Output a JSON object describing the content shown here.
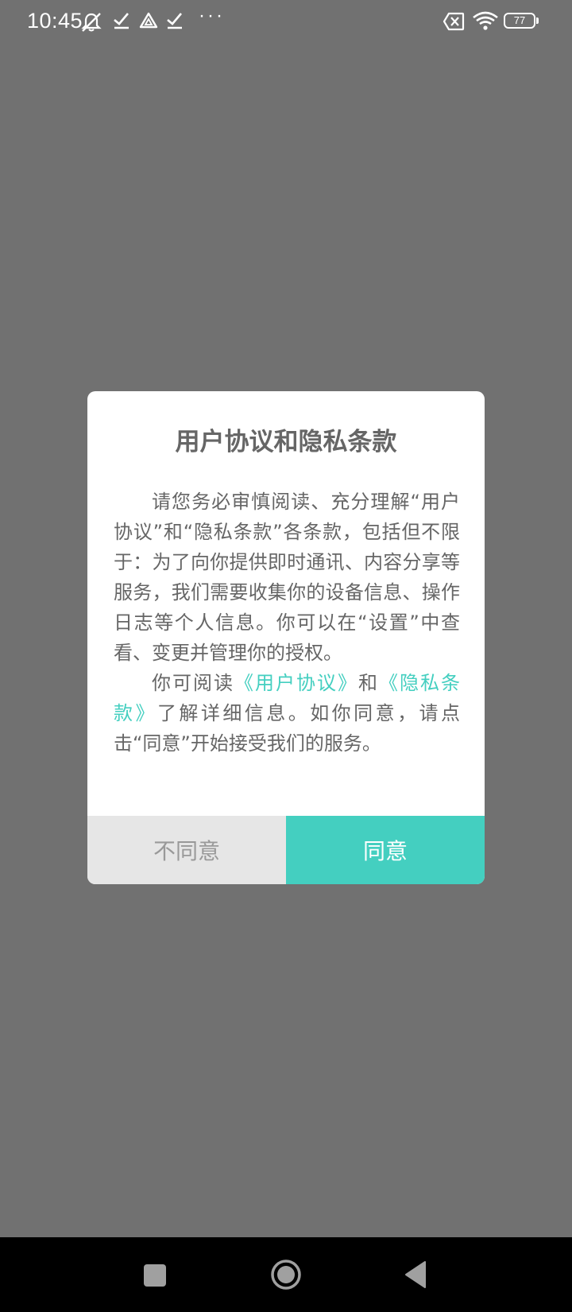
{
  "status_bar": {
    "time": "10:45",
    "overflow_dots": "···",
    "battery_level": "77",
    "icons": [
      "mute-icon",
      "check-icon",
      "drive-icon",
      "check-icon",
      "sim-absent-icon",
      "wifi-icon",
      "battery-icon"
    ]
  },
  "dialog": {
    "title": "用户协议和隐私条款",
    "paragraph1": "请您务必审慎阅读、充分理解“用户协议”和“隐私条款”各条款，包括但不限于：为了向你提供即时通讯、内容分享等服务，我们需要收集你的设备信息、操作日志等个人信息。你可以在“设置”中查看、变更并管理你的授权。",
    "paragraph2": {
      "prefix": "你可阅读",
      "link_user_agreement": "《用户协议》",
      "middle": "和",
      "link_privacy": "《隐私条款》",
      "suffix": "了解详细信息。如你同意，请点击“同意”开始接受我们的服务。"
    },
    "disagree_label": "不同意",
    "agree_label": "同意"
  },
  "nav_bar": {
    "icons": [
      "recents-square-icon",
      "home-circle-icon",
      "back-triangle-icon"
    ]
  },
  "colors": {
    "accent": "#44cfc0",
    "overlay": "#717171",
    "dialog_text": "#666666",
    "disagree_bg": "#e6e6e6"
  }
}
